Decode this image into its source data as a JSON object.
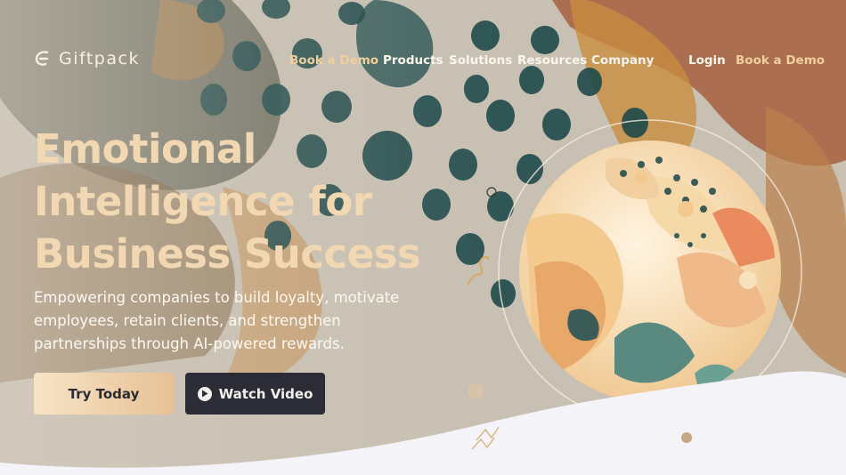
{
  "brand": {
    "name": "Giftpack",
    "logo_icon": "giftpack-logo-icon"
  },
  "nav": {
    "items": [
      {
        "label": "Book a Demo",
        "accent": true
      },
      {
        "label": "Products",
        "accent": false
      },
      {
        "label": "Solutions",
        "accent": false
      },
      {
        "label": "Resources",
        "accent": false
      },
      {
        "label": "Company",
        "accent": false
      },
      {
        "label": "Login",
        "accent": false
      },
      {
        "label": "Book a Demo",
        "accent": true
      }
    ]
  },
  "hero": {
    "title_lines": [
      "Emotional",
      "Intelligence for",
      "Business Success"
    ],
    "subtitle": "Empowering companies to build loyalty, motivate employees, retain clients, and strengthen partnerships through AI-powered rewards.",
    "primary_cta": "Try Today",
    "secondary_cta": "Watch Video",
    "secondary_icon": "play-icon"
  },
  "colors": {
    "accent": "#efcf9e",
    "title": "#f1d8b3",
    "dark_button": "#2c2c36",
    "wave": "#f4f3f8"
  }
}
